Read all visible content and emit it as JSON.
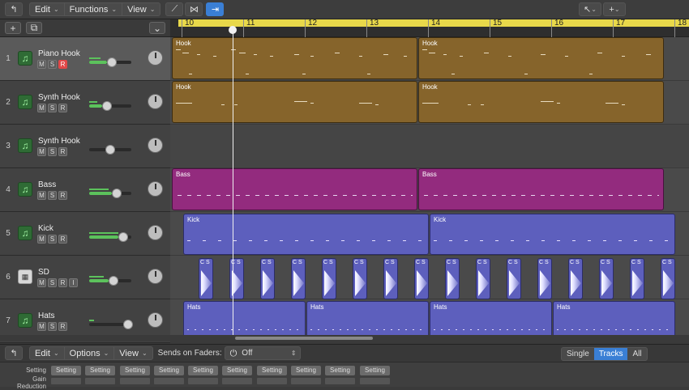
{
  "toolbar": {
    "back_icon": "back-arrow-icon",
    "edit": "Edit",
    "functions": "Functions",
    "view": "View"
  },
  "ruler": {
    "bars": [
      "10",
      "11",
      "12",
      "13",
      "14",
      "15",
      "16",
      "17",
      "18"
    ]
  },
  "tracks": [
    {
      "num": "1",
      "name": "Piano Hook",
      "m": "M",
      "s": "S",
      "r": "R",
      "record_armed": true,
      "volume": 0.5
    },
    {
      "num": "2",
      "name": "Synth Hook",
      "m": "M",
      "s": "S",
      "r": "R",
      "record_armed": false,
      "volume": 0.4
    },
    {
      "num": "3",
      "name": "Synth Hook",
      "m": "M",
      "s": "S",
      "r": "R",
      "record_armed": false,
      "volume": 0.45
    },
    {
      "num": "4",
      "name": "Bass",
      "m": "M",
      "s": "S",
      "r": "R",
      "record_armed": false,
      "volume": 0.6
    },
    {
      "num": "5",
      "name": "Kick",
      "m": "M",
      "s": "S",
      "r": "R",
      "record_armed": false,
      "volume": 0.75
    },
    {
      "num": "6",
      "name": "SD",
      "m": "M",
      "s": "S",
      "r": "R",
      "i": "I",
      "record_armed": false,
      "volume": 0.55
    },
    {
      "num": "7",
      "name": "Hats",
      "m": "M",
      "s": "S",
      "r": "R",
      "record_armed": false,
      "volume": 0.85
    }
  ],
  "regions": {
    "piano": [
      "Hook",
      "Hook"
    ],
    "synth": [
      "Hook",
      "Hook"
    ],
    "bass": [
      "Bass",
      "Bass"
    ],
    "kick": [
      "Kick",
      "Kick"
    ],
    "sd_label": "C S",
    "hats": [
      "Hats",
      "Hats",
      "Hats",
      "Hats"
    ]
  },
  "mixer": {
    "edit": "Edit",
    "options": "Options",
    "view": "View",
    "sends_label": "Sends on Faders:",
    "sends_value": "Off",
    "single": "Single",
    "tracks": "Tracks",
    "all": "All",
    "setting_label": "Setting",
    "gain_reduction_label": "Gain Reduction",
    "setting_btn": "Setting"
  },
  "colors": {
    "gold_region": "#86642b",
    "purple_region": "#932b7e",
    "blue_region": "#5d5fbd",
    "ruler_yellow": "#e8d84a",
    "accent_blue": "#3a7fd5",
    "record_red": "#e04848"
  }
}
